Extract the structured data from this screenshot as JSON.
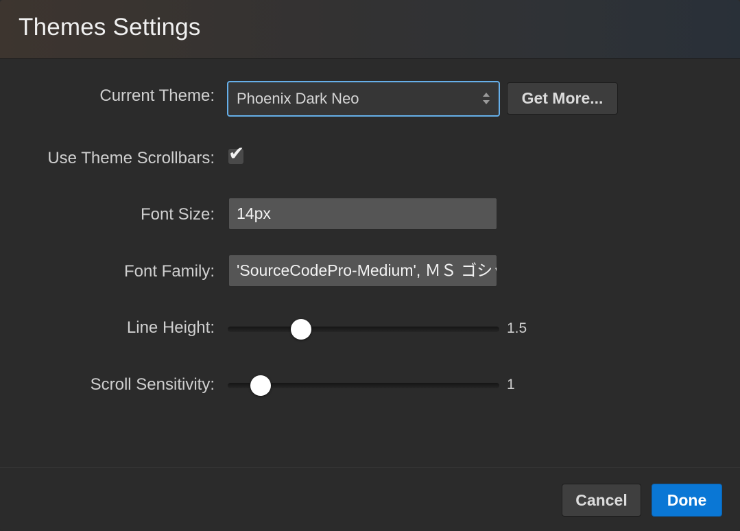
{
  "header": {
    "title": "Themes Settings"
  },
  "current_theme": {
    "label": "Current Theme:",
    "value": "Phoenix Dark Neo",
    "get_more_label": "Get More..."
  },
  "scrollbars": {
    "label": "Use Theme Scrollbars:",
    "checked": true,
    "check_glyph": "✔"
  },
  "font_size": {
    "label": "Font Size:",
    "value": "14px"
  },
  "font_family": {
    "label": "Font Family:",
    "value": "'SourceCodePro-Medium', ＭＳ ゴシック"
  },
  "line_height": {
    "label": "Line Height:",
    "value": "1.5",
    "level_fraction": 0.27
  },
  "scroll_sensitivity": {
    "label": "Scroll Sensitivity:",
    "value": "1",
    "level_fraction": 0.12
  },
  "footer": {
    "cancel_label": "Cancel",
    "done_label": "Done"
  },
  "colors": {
    "accent": "#0a77d5",
    "focus_border": "#66afe9",
    "background": "#2b2b2b"
  },
  "icons": {
    "select_arrows": "updown-arrows-icon",
    "checkbox": "checkmark-icon"
  }
}
